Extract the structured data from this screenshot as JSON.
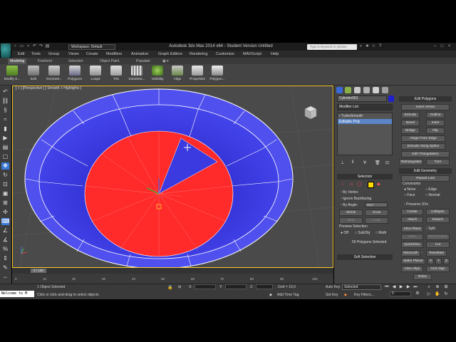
{
  "window": {
    "title": "Autodesk 3ds Max  2014 x64   - Student Version   Untitled",
    "workspace": "Workspace: Default",
    "search_placeholder": "Type a keyword or phrase"
  },
  "menu": [
    "Edit",
    "Tools",
    "Group",
    "Views",
    "Create",
    "Modifiers",
    "Animation",
    "Graph Editors",
    "Rendering",
    "Customize",
    "MAXScript",
    "Help"
  ],
  "ribbon": {
    "tabs": [
      "Modeling",
      "Freeform",
      "Selection",
      "Object Paint",
      "Populate"
    ],
    "active_tab": "Modeling",
    "buttons": [
      "Modify S...",
      "Edit",
      "Geometr...",
      "Polygons",
      "Loops",
      "Tris",
      "Subdivisi...",
      "Visibility",
      "Align",
      "Properties",
      "Polygon..."
    ]
  },
  "viewport": {
    "label": "[ + ] [Perspective ] [ Smooth + Highlights ]"
  },
  "command_panel": {
    "object_name": "Cylinder001",
    "modifier_list": "Modifier List",
    "stack": [
      "TurboSmooth",
      "Editable Poly"
    ],
    "edit_polygons": {
      "header": "Edit Polygons",
      "insert_vertex": "Insert Vertex",
      "rows": [
        [
          "Extrude",
          "Outline"
        ],
        [
          "Bevel",
          "Inset"
        ],
        [
          "Bridge",
          "Flip"
        ]
      ],
      "hinge": "Hinge From Edge",
      "extrude_spline": "Extrude Along Spline",
      "edit_triangulation": "Edit Triangulation",
      "retriangulate": "Retriangulate",
      "turn": "Turn"
    },
    "edit_geometry": {
      "header": "Edit Geometry",
      "repeat_last": "Repeat Last",
      "constraints": "Constraints",
      "opt_none": "None",
      "opt_edge": "Edge",
      "opt_face": "Face",
      "opt_normal": "Normal",
      "preserve_uvs": "Preserve UVs",
      "create": "Create",
      "collapse": "Collapse",
      "attach": "Attach",
      "detach": "Detach",
      "slice_plane": "Slice Plane",
      "split": "Split",
      "slice": "Slice",
      "reset_plane": "Reset Plane",
      "quickslice": "QuickSlice",
      "cut": "Cut",
      "msmooth": "MSmooth",
      "tessellate": "Tessellate",
      "make_planar": "Make Planar",
      "x": "X",
      "y": "Y",
      "z": "Z",
      "view_align": "View Align",
      "grid_align": "Grid Align",
      "relax": "Relax"
    },
    "selection": {
      "header": "Selection",
      "by_vertex": "By Vertex",
      "ignore_backfacing": "Ignore Backfacing",
      "by_angle": "By Angle:",
      "angle_value": "45,0",
      "shrink": "Shrink",
      "grow": "Grow",
      "ring": "Ring",
      "loop": "Loop",
      "preview_selection": "Preview Selection",
      "preview_off": "Off",
      "preview_subobj": "SubObj",
      "preview_multi": "Multi",
      "status": "59 Polygons Selected"
    },
    "soft_selection": "Soft Selection"
  },
  "timeline": {
    "slider": "0 / 100",
    "ticks": [
      "0",
      "10",
      "20",
      "30",
      "40",
      "50",
      "60",
      "70",
      "80",
      "90",
      "100"
    ]
  },
  "status": {
    "welcome": "Welcome to M",
    "objects_selected": "1 Object Selected",
    "prompt": "Click or click-and-drag to select objects",
    "x_label": "X:",
    "y_label": "Y:",
    "z_label": "Z:",
    "grid": "Grid = 10,0",
    "add_time_tag": "Add Time Tag",
    "auto_key": "Auto Key",
    "set_key": "Set Key",
    "selected": "Selected",
    "key_filters": "Key Filters...",
    "frame": "0"
  },
  "colors": {
    "object_blue": "#3a3ae0",
    "selected_red": "#ff2a2a",
    "viewport_bg": "#4a4a4a",
    "active_border": "#ffcc33"
  }
}
